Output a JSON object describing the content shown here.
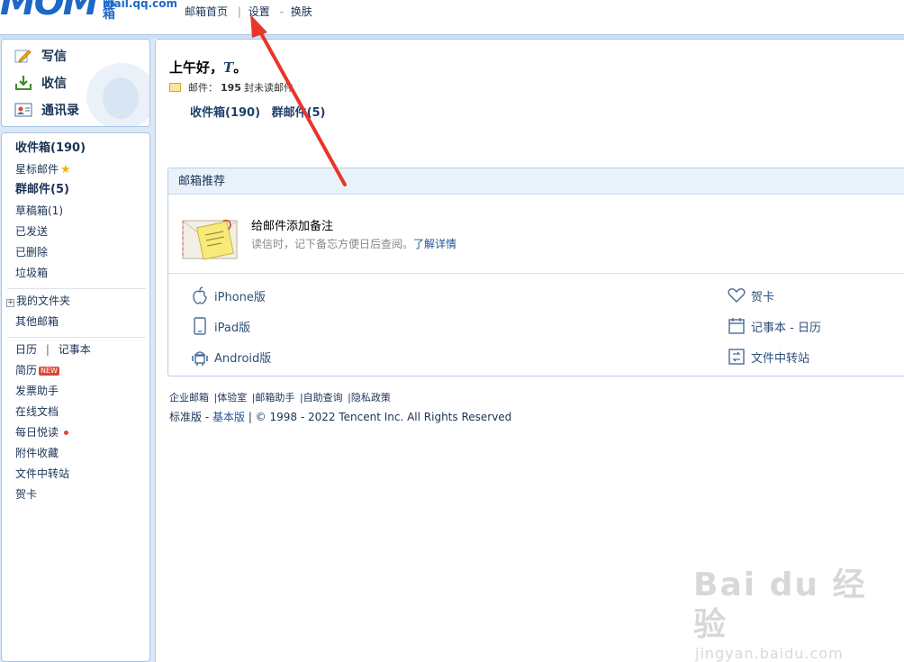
{
  "brand": {
    "logo_text": "MOM",
    "title": "QQ邮箱",
    "domain": "mail.qq.com"
  },
  "topnav": {
    "home": "邮箱首页",
    "separator": "|",
    "settings": "设置",
    "dash": "-",
    "skin": "换肤"
  },
  "quick": {
    "compose": "写信",
    "receive": "收信",
    "contacts": "通讯录"
  },
  "folders": {
    "inbox": "收件箱(190)",
    "starred": "星标邮件",
    "group": "群邮件(5)",
    "drafts": "草稿箱(1)",
    "sent": "已发送",
    "deleted": "已删除",
    "spam": "垃圾箱",
    "my_folders": "我的文件夹",
    "other_mailbox": "其他邮箱",
    "calendar": "日历",
    "cal_sep": "|",
    "notebook": "记事本",
    "resume": "简历",
    "resume_badge": "NEW",
    "invoice": "发票助手",
    "docs": "在线文档",
    "daily": "每日悦读",
    "attachments": "附件收藏",
    "transfer": "文件中转站",
    "cards": "贺卡"
  },
  "main": {
    "greeting": "上午好，",
    "username": "T",
    "greeting_end": "。",
    "unread_prefix": "邮件：",
    "unread_count": "195",
    "unread_suffix": "封未读邮件",
    "inbox_link": "收件箱(190)",
    "group_link": "群邮件(5)"
  },
  "recommend": {
    "title": "邮箱推荐",
    "item_title": "给邮件添加备注",
    "item_desc": "读信时，记下备忘方便日后查阅。",
    "item_link": "了解详情",
    "apps_left": [
      "iPhone版",
      "iPad版",
      "Android版"
    ],
    "apps_left_icons": [
      "apple-icon",
      "tablet-icon",
      "android-icon"
    ],
    "apps_right": [
      "贺卡",
      "记事本 - 日历",
      "文件中转站"
    ],
    "apps_right_icons": [
      "heart-icon",
      "calendar-icon",
      "transfer-icon"
    ]
  },
  "footer": {
    "links": [
      "企业邮箱",
      "|体验室",
      "|邮箱助手",
      "|自助查询",
      "|隐私政策"
    ],
    "standard": "标准版",
    "dash": " - ",
    "basic": "基本版",
    "copyright": " | © 1998 - 2022 Tencent Inc. All Rights Reserved"
  },
  "watermark": {
    "line1": "Bai du 经验",
    "line2": "jingyan.baidu.com"
  },
  "colors": {
    "accent": "#1d67c8",
    "sidebar_bg": "#dbe8f6",
    "arrow": "#e8352a"
  }
}
